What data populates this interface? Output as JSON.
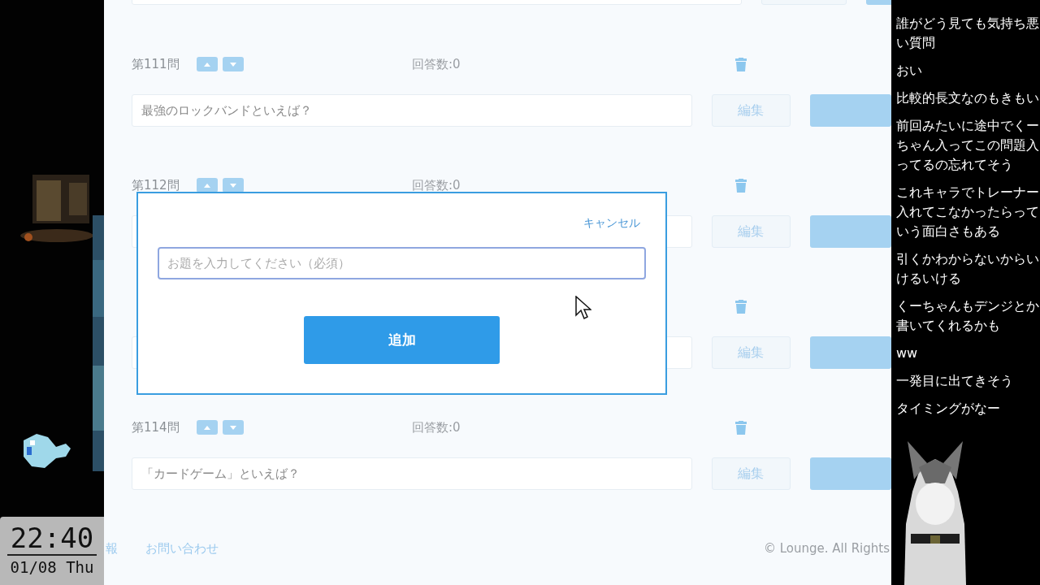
{
  "clock": {
    "time": "22:40",
    "date": "01/08 Thu"
  },
  "page": {
    "questions": [
      {
        "label": "第111問",
        "answers": "回答数:0",
        "text": "最強のロックバンドといえば？",
        "edit": "編集"
      },
      {
        "label": "第112問",
        "answers": "回答数:0",
        "edit": "編集"
      },
      {
        "edit": "編集"
      },
      {
        "label": "第114問",
        "answers": "回答数:0",
        "text": "「カードゲーム」といえば？",
        "edit": "編集"
      }
    ],
    "footer": {
      "links": [
        "報",
        "お問い合わせ"
      ],
      "copyright": "© Lounge. All Rights"
    }
  },
  "dialog": {
    "cancel": "キャンセル",
    "input": {
      "placeholder": "お題を入力してください（必須）"
    },
    "submit": "追加"
  },
  "chat": {
    "messages": [
      "誰がどう見ても気持ち悪い質問",
      "おい",
      "比較的長文なのもきもい",
      "前回みたいに途中でくーちゃん入ってこの問題入ってるの忘れてそう",
      "これキャラでトレーナー入れてこなかったらっていう面白さもある",
      "引くかわからないからいけるいける",
      "くーちゃんもデンジとか書いてくれるかも",
      "ww",
      "一発目に出てきそう",
      "タイミングがなー"
    ]
  }
}
